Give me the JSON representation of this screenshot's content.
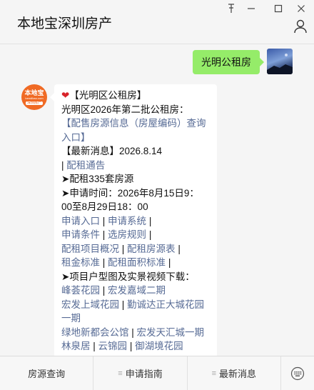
{
  "window": {
    "title": "本地宝深圳房产",
    "controls": {
      "pin": "⊥",
      "minimize": "—",
      "maximize": "☐",
      "close": "✕"
    }
  },
  "chat": {
    "sent_message": "光明公租房",
    "reply": {
      "line1_prefix": "【光明区公租房】",
      "line2": "光明区2026年第二批公租房：",
      "link_presale_a": "【配售房源信息（房屋编码）查询",
      "link_presale_b": "入口】",
      "latest_label": "【最新消息】",
      "latest_date": "2026.8.14",
      "sep": "|",
      "notice_link": "配租通告",
      "arrow": "➤",
      "units_text": "配租335套房源",
      "apply_time_a": "申请时间：2026年8月15日9：",
      "apply_time_b": "00至8月29日18：00",
      "links_row1": [
        "申请入口",
        "申请系统"
      ],
      "links_row2": [
        "申请条件",
        "选房规则"
      ],
      "links_row3": [
        "配租项目概况",
        "配租房源表"
      ],
      "links_row4": [
        "租金标准",
        "配租面积标准"
      ],
      "video_text": "项目户型图及实景视频下载：",
      "projects_row1": [
        "峰荟花园",
        "宏发嘉域二期"
      ],
      "projects_row2a": "宏发上域花园",
      "projects_row2b": "勤诚达正大城花园",
      "projects_row2c": "一期",
      "projects_row3": [
        "绿地新都会公馆",
        "宏发天汇城一期"
      ],
      "projects_row4": [
        "林泉居",
        "云锦园",
        "御湖境花园"
      ]
    },
    "bot_avatar": {
      "line1": "本地宝",
      "line2": "bendibao.com",
      "line3": "深圳房产"
    }
  },
  "menu": {
    "items": [
      "房源查询",
      "申请指南",
      "最新消息"
    ],
    "menu_icon": "≡"
  },
  "colors": {
    "link": "#576b95",
    "sent_bubble": "#95ec69",
    "bot_avatar": "#f06a24",
    "heart": "#d8232a"
  },
  "icons": [
    "pin-icon",
    "minimize-icon",
    "maximize-icon",
    "close-icon",
    "user-icon",
    "heart-icon",
    "arrow-icon",
    "menu-lines-icon",
    "keyboard-icon"
  ]
}
